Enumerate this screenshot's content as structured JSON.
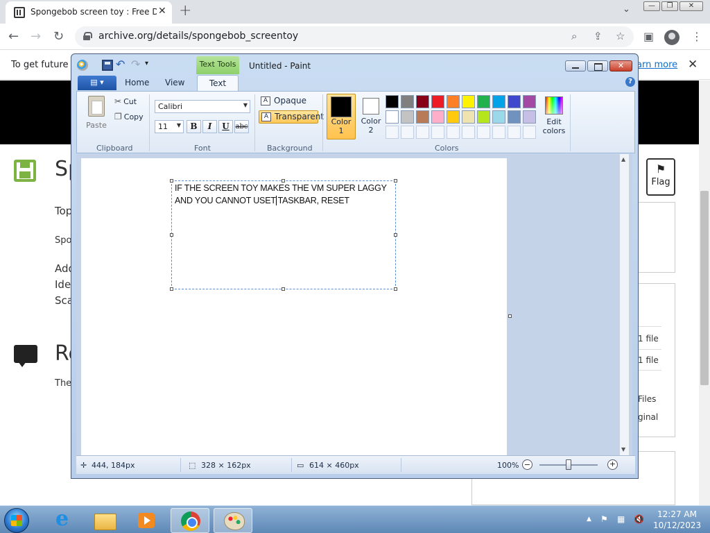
{
  "browser": {
    "tab_title": "Spongebob screen toy : Free Dov",
    "new_tab": "+",
    "tab_close": "✕",
    "url": "archive.org/details/spongebob_screentoy",
    "window_controls": [
      "—",
      "❐",
      "✕"
    ]
  },
  "page": {
    "banner_text": "To get future G",
    "banner_link": "earn more",
    "heading": "Sp",
    "line_top": "Top",
    "line_spo": "Spo",
    "line_add": "Add",
    "line_ide": "Ide",
    "line_sca": "Sca",
    "reviews_heading": "Re",
    "reviews_text": "The",
    "flag_label": "Flag",
    "side_items": [
      "1 file",
      "1 file",
      "Files",
      "ginal"
    ]
  },
  "paint": {
    "context_tab": "Text Tools",
    "title": "Untitled - Paint",
    "tabs": {
      "home": "Home",
      "view": "View",
      "text": "Text"
    },
    "help": "?",
    "clipboard": {
      "paste": "Paste",
      "cut": "Cut",
      "copy": "Copy",
      "label": "Clipboard"
    },
    "font": {
      "name": "Calibri",
      "size": "11",
      "bold": "B",
      "italic": "I",
      "underline": "U",
      "strike": "abc",
      "label": "Font"
    },
    "background": {
      "opaque": "Opaque",
      "transparent": "Transparent",
      "label": "Background"
    },
    "colors": {
      "color1": "Color",
      "color1_num": "1",
      "color2": "Color",
      "color2_num": "2",
      "edit": "Edit",
      "edit2": "colors",
      "label": "Colors",
      "palette_row1": [
        "#000000",
        "#7f7f7f",
        "#880015",
        "#ed1c24",
        "#ff7f27",
        "#fff200",
        "#22b14c",
        "#00a2e8",
        "#3f48cc",
        "#a349a4"
      ],
      "palette_row2": [
        "#ffffff",
        "#c3c3c3",
        "#b97a57",
        "#ffaec9",
        "#ffc90e",
        "#efe4b0",
        "#b5e61d",
        "#99d9ea",
        "#7092be",
        "#c8bfe7"
      ]
    },
    "canvas_text": {
      "line1": "IF THE SCREEN TOY MAKES THE VM SUPER LAGGY",
      "line2": "AND YOU CANNOT USET TASKBAR, RESET"
    },
    "status": {
      "cursor_pos": "444, 184px",
      "selection_size": "328 × 162px",
      "image_size": "614 × 460px",
      "zoom": "100%"
    }
  },
  "taskbar": {
    "time": "12:27 AM",
    "date": "10/12/2023"
  }
}
